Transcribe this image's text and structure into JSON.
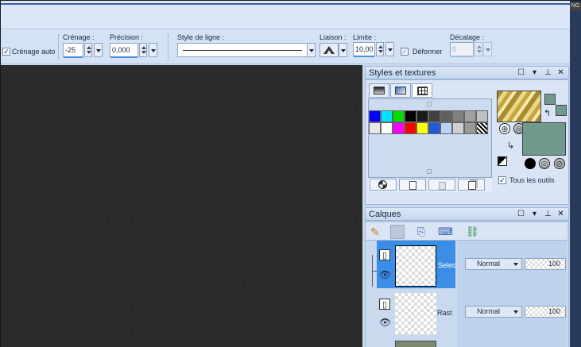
{
  "window": {
    "corner_tag": "NG"
  },
  "toolbar": {
    "crenage_auto": {
      "label": "Crénage auto",
      "checked": true
    },
    "crenage": {
      "label": "Crénage :",
      "value": "-25"
    },
    "precision": {
      "label": "Précision :",
      "value": "0,000"
    },
    "style_ligne": {
      "label": "Style de ligne :"
    },
    "liaison": {
      "label": "Liaison :"
    },
    "limite": {
      "label": "Limite :",
      "value": "10,00"
    },
    "deformer": {
      "label": "Déformer",
      "checked": true
    },
    "decalage": {
      "label": "Décalage :",
      "value": "0"
    }
  },
  "styles_panel": {
    "title": "Styles et textures",
    "tous_les_outils": {
      "label": "Tous les outils",
      "checked": true
    },
    "swatch_colors_row1": [
      "#0000ff",
      "#00e5ff",
      "#00e000",
      "#000000",
      "#1a1a1a",
      "#404040",
      "#606060",
      "#808080",
      "#a0a0a0",
      "#c0c0c0"
    ],
    "swatch_colors_row2": [
      "#e8e8e8",
      "#ffffff",
      "#ff00ff",
      "#ff0000",
      "#ffff00",
      "#1e5bd8",
      "#b9d3f5",
      "#d0d0d0",
      "#9a9a9a"
    ],
    "foreground_color": "#c7a53a",
    "background_color": "#6f9a8c"
  },
  "calques_panel": {
    "title": "Calques",
    "layers": [
      {
        "name": "Selec",
        "blend": "Normal",
        "opacity": "100",
        "selected": true
      },
      {
        "name": "Rast",
        "blend": "Normal",
        "opacity": "100",
        "selected": false
      }
    ]
  },
  "colors": {
    "accent": "#4a8de0",
    "selected_layer": "#3b8ee8",
    "canvas": "#2a2a2a"
  }
}
